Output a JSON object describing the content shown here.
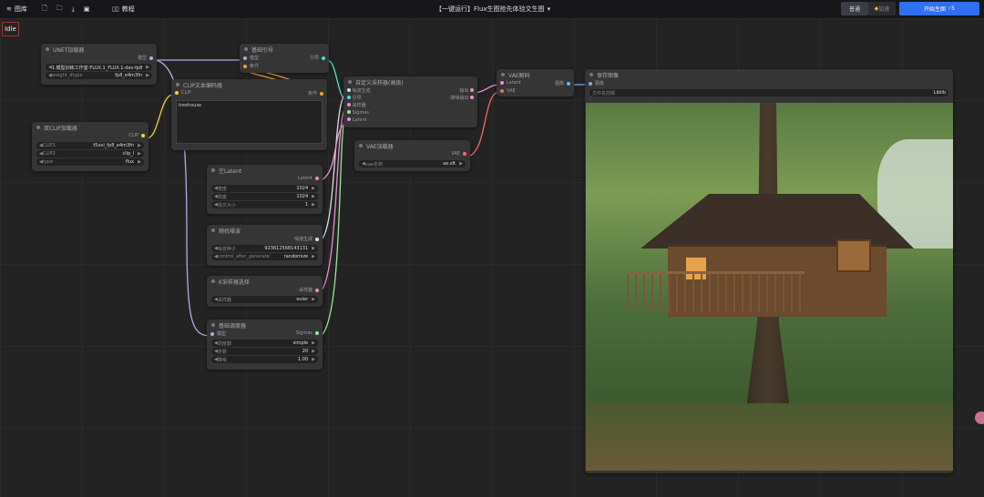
{
  "topbar": {
    "library": "图库",
    "tutorial": "教程",
    "title": "【一键运行】Flux生图抢先体验文生图",
    "mode": "普通",
    "pro": "加速",
    "run": "开始生图",
    "run_cost": "5"
  },
  "status": "Idle",
  "nodes": {
    "unet": {
      "title": "UNET加载器",
      "out": "模型",
      "unet_name": "1.模型训练工作室-FLUX.1_FLUX.1-dev-fp8",
      "weight_dtype_label": "weight_dtype",
      "weight_dtype": "fp8_e4m3fn"
    },
    "guider": {
      "title": "基础引导",
      "in1": "模型",
      "in2": "条件",
      "out": "引导"
    },
    "clipenc": {
      "title": "CLIP文本编码器",
      "in": "CLIP",
      "out": "条件",
      "text": "treehouse"
    },
    "dualclip": {
      "title": "双CLIP加载器",
      "out": "CLIP",
      "clip1_label": "CLIP1",
      "clip1": "t5xxl_fp8_e4m3fn",
      "clip2_label": "CLIP2",
      "clip2": "clip_l",
      "type_label": "type",
      "type": "flux"
    },
    "sampler": {
      "title": "自定义采样器(高级)",
      "in": [
        "噪波生成",
        "引导",
        "采样器",
        "Sigmas",
        "Latent"
      ],
      "out1": "输出",
      "out2": "降噪输出"
    },
    "vaedecode": {
      "title": "VAE解码",
      "in1": "Latent",
      "in2": "VAE",
      "out": "图像"
    },
    "save": {
      "title": "保存图像",
      "in": "图像",
      "prefix_label": "文件名前缀",
      "prefix": "Liblib"
    },
    "vaeload": {
      "title": "VAE加载器",
      "out": "VAE",
      "name_label": "vae名称",
      "name": "ae.sft"
    },
    "latent": {
      "title": "空Latent",
      "out": "Latent",
      "width_label": "宽度",
      "width": "1024",
      "height_label": "高度",
      "height": "1024",
      "batch_label": "批次大小",
      "batch": "1"
    },
    "noise": {
      "title": "随机噪波",
      "out": "噪波生成",
      "seed_label": "噪波种子",
      "seed": "923612568143131",
      "control_label": "control_after_generate",
      "control": "randomize"
    },
    "ksel": {
      "title": "K采样器选择",
      "out": "采样器",
      "sampler_label": "采样器",
      "sampler": "euler"
    },
    "sched": {
      "title": "基础调度器",
      "in": "模型",
      "out": "Sigmas",
      "scheduler_label": "调度器",
      "scheduler": "simple",
      "steps_label": "步数",
      "steps": "20",
      "denoise_label": "降噪",
      "denoise": "1.00"
    }
  },
  "colors": {
    "accent": "#2f6ff2",
    "model": "#b3a9e8",
    "clip": "#f2d33a",
    "cond": "#f0a030",
    "latent": "#e98fd0",
    "vae": "#f06a6a",
    "image": "#64b5f6",
    "guider": "#4ee0d0",
    "sigmas": "#9be89b"
  }
}
